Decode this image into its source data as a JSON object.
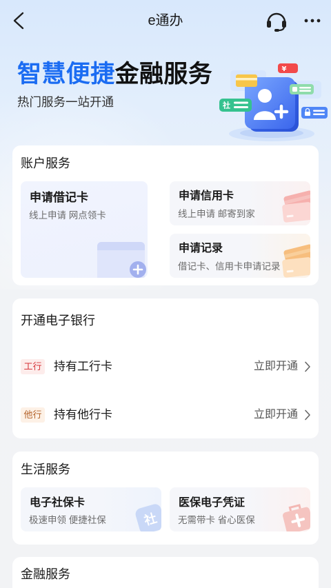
{
  "nav": {
    "title": "e通办",
    "back_icon": "chevron-left-icon",
    "support_icon": "headset-icon",
    "more_icon": "more-dots-icon"
  },
  "hero": {
    "title_highlight": "智慧便捷",
    "title_rest": "金融服务",
    "subtitle": "热门服务一站开通",
    "illustration": {
      "yen_badge": "¥",
      "social_badge": "社"
    }
  },
  "account_services": {
    "title": "账户服务",
    "debit_card": {
      "title": "申请借记卡",
      "subtitle": "线上申请 网点领卡",
      "icon": "debit-card-plus-icon"
    },
    "credit_card": {
      "title": "申请信用卡",
      "subtitle": "线上申请 邮寄到家",
      "icon": "credit-card-icon"
    },
    "records": {
      "title": "申请记录",
      "subtitle": "借记卡、信用卡申请记录",
      "icon": "card-records-icon"
    }
  },
  "ebanking": {
    "title": "开通电子银行",
    "rows": [
      {
        "badge": "工行",
        "label": "持有工行卡",
        "action": "立即开通",
        "icon": "chevron-right-icon"
      },
      {
        "badge": "他行",
        "label": "持有他行卡",
        "action": "立即开通",
        "icon": "chevron-right-icon"
      }
    ]
  },
  "life_services": {
    "title": "生活服务",
    "tiles": [
      {
        "title": "电子社保卡",
        "subtitle": "极速申领 便捷社保",
        "icon_text": "社",
        "icon": "social-security-icon"
      },
      {
        "title": "医保电子凭证",
        "subtitle": "无需带卡 省心医保",
        "icon": "medical-kit-icon"
      }
    ]
  },
  "financial_services": {
    "title": "金融服务"
  },
  "colors": {
    "accent": "#1b6cf2",
    "icbc_badge_text": "#d6353a",
    "icbc_badge_bg": "#fdeceb",
    "other_badge_text": "#b3622a",
    "other_badge_bg": "#fdf1e6"
  }
}
